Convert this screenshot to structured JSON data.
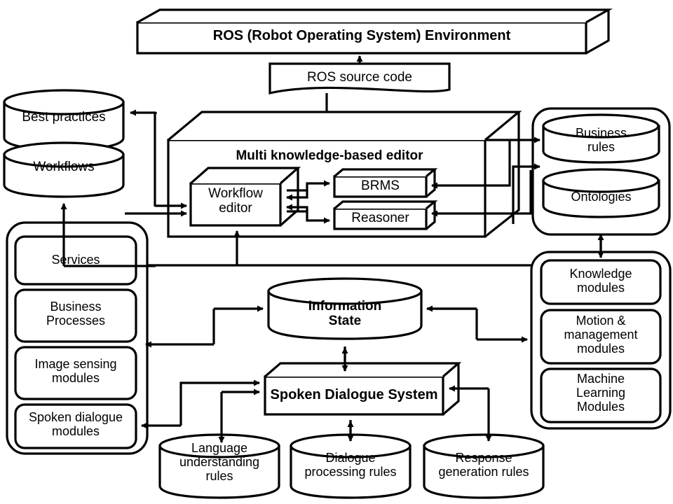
{
  "diagram": {
    "title": "ROS-based multi knowledge-based editor architecture",
    "stroke_color": "#000000",
    "fill_color": "#ffffff"
  },
  "nodes": {
    "ros_environment": {
      "label": "ROS (Robot Operating System) Environment",
      "shape": "3d-box",
      "bold": true
    },
    "ros_source_code": {
      "label": "ROS source code",
      "shape": "document",
      "bold": false
    },
    "best_practices": {
      "label": "Best practices",
      "shape": "cylinder",
      "bold": false
    },
    "workflows": {
      "label": "Workflows",
      "shape": "cylinder",
      "bold": false
    },
    "editor": {
      "label": "Multi knowledge-based editor",
      "shape": "3d-box",
      "bold": true
    },
    "workflow_editor": {
      "label": "Workflow\neditor",
      "line1": "Workflow",
      "line2": "editor",
      "shape": "3d-box",
      "bold": false
    },
    "brms": {
      "label": "BRMS",
      "shape": "3d-box",
      "bold": false
    },
    "reasoner": {
      "label": "Reasoner",
      "shape": "3d-box",
      "bold": false
    },
    "business_rules": {
      "line1": "Business",
      "line2": "rules",
      "shape": "cylinder",
      "bold": false
    },
    "ontologies": {
      "label": "Ontologies",
      "shape": "cylinder",
      "bold": false
    },
    "knowledge_modules": {
      "line1": "Knowledge",
      "line2": "modules",
      "shape": "rounded-rect",
      "bold": false
    },
    "motion_modules": {
      "line1": "Motion &",
      "line2": "management",
      "line3": "modules",
      "shape": "rounded-rect",
      "bold": false
    },
    "ml_modules": {
      "line1": "Machine",
      "line2": "Learning",
      "line3": "Modules",
      "shape": "rounded-rect",
      "bold": false
    },
    "services": {
      "label": "Services",
      "shape": "rounded-rect",
      "bold": false
    },
    "business_processes": {
      "line1": "Business",
      "line2": "Processes",
      "shape": "rounded-rect",
      "bold": false
    },
    "image_sensing_modules": {
      "line1": "Image sensing",
      "line2": "modules",
      "shape": "rounded-rect",
      "bold": false
    },
    "spoken_dialogue_modules": {
      "line1": "Spoken dialogue",
      "line2": "modules",
      "shape": "rounded-rect",
      "bold": false
    },
    "information_state": {
      "line1": "Information",
      "line2": "State",
      "shape": "cylinder",
      "bold": true
    },
    "spoken_dialogue_system": {
      "label": "Spoken Dialogue System",
      "shape": "3d-box",
      "bold": true
    },
    "language_understanding_rules": {
      "line1": "Language",
      "line2": "understanding",
      "line3": "rules",
      "shape": "cylinder",
      "bold": false
    },
    "dialogue_processing_rules": {
      "line1": "Dialogue",
      "line2": "processing rules",
      "shape": "cylinder",
      "bold": false
    },
    "response_generation_rules": {
      "line1": "Response",
      "line2": "generation rules",
      "shape": "cylinder",
      "bold": false
    }
  },
  "groups": {
    "right_knowledge_group": {
      "name": "knowledge-bases-group"
    },
    "right_modules_group": {
      "name": "robot-modules-group"
    },
    "left_modules_group": {
      "name": "left-modules-group"
    }
  }
}
